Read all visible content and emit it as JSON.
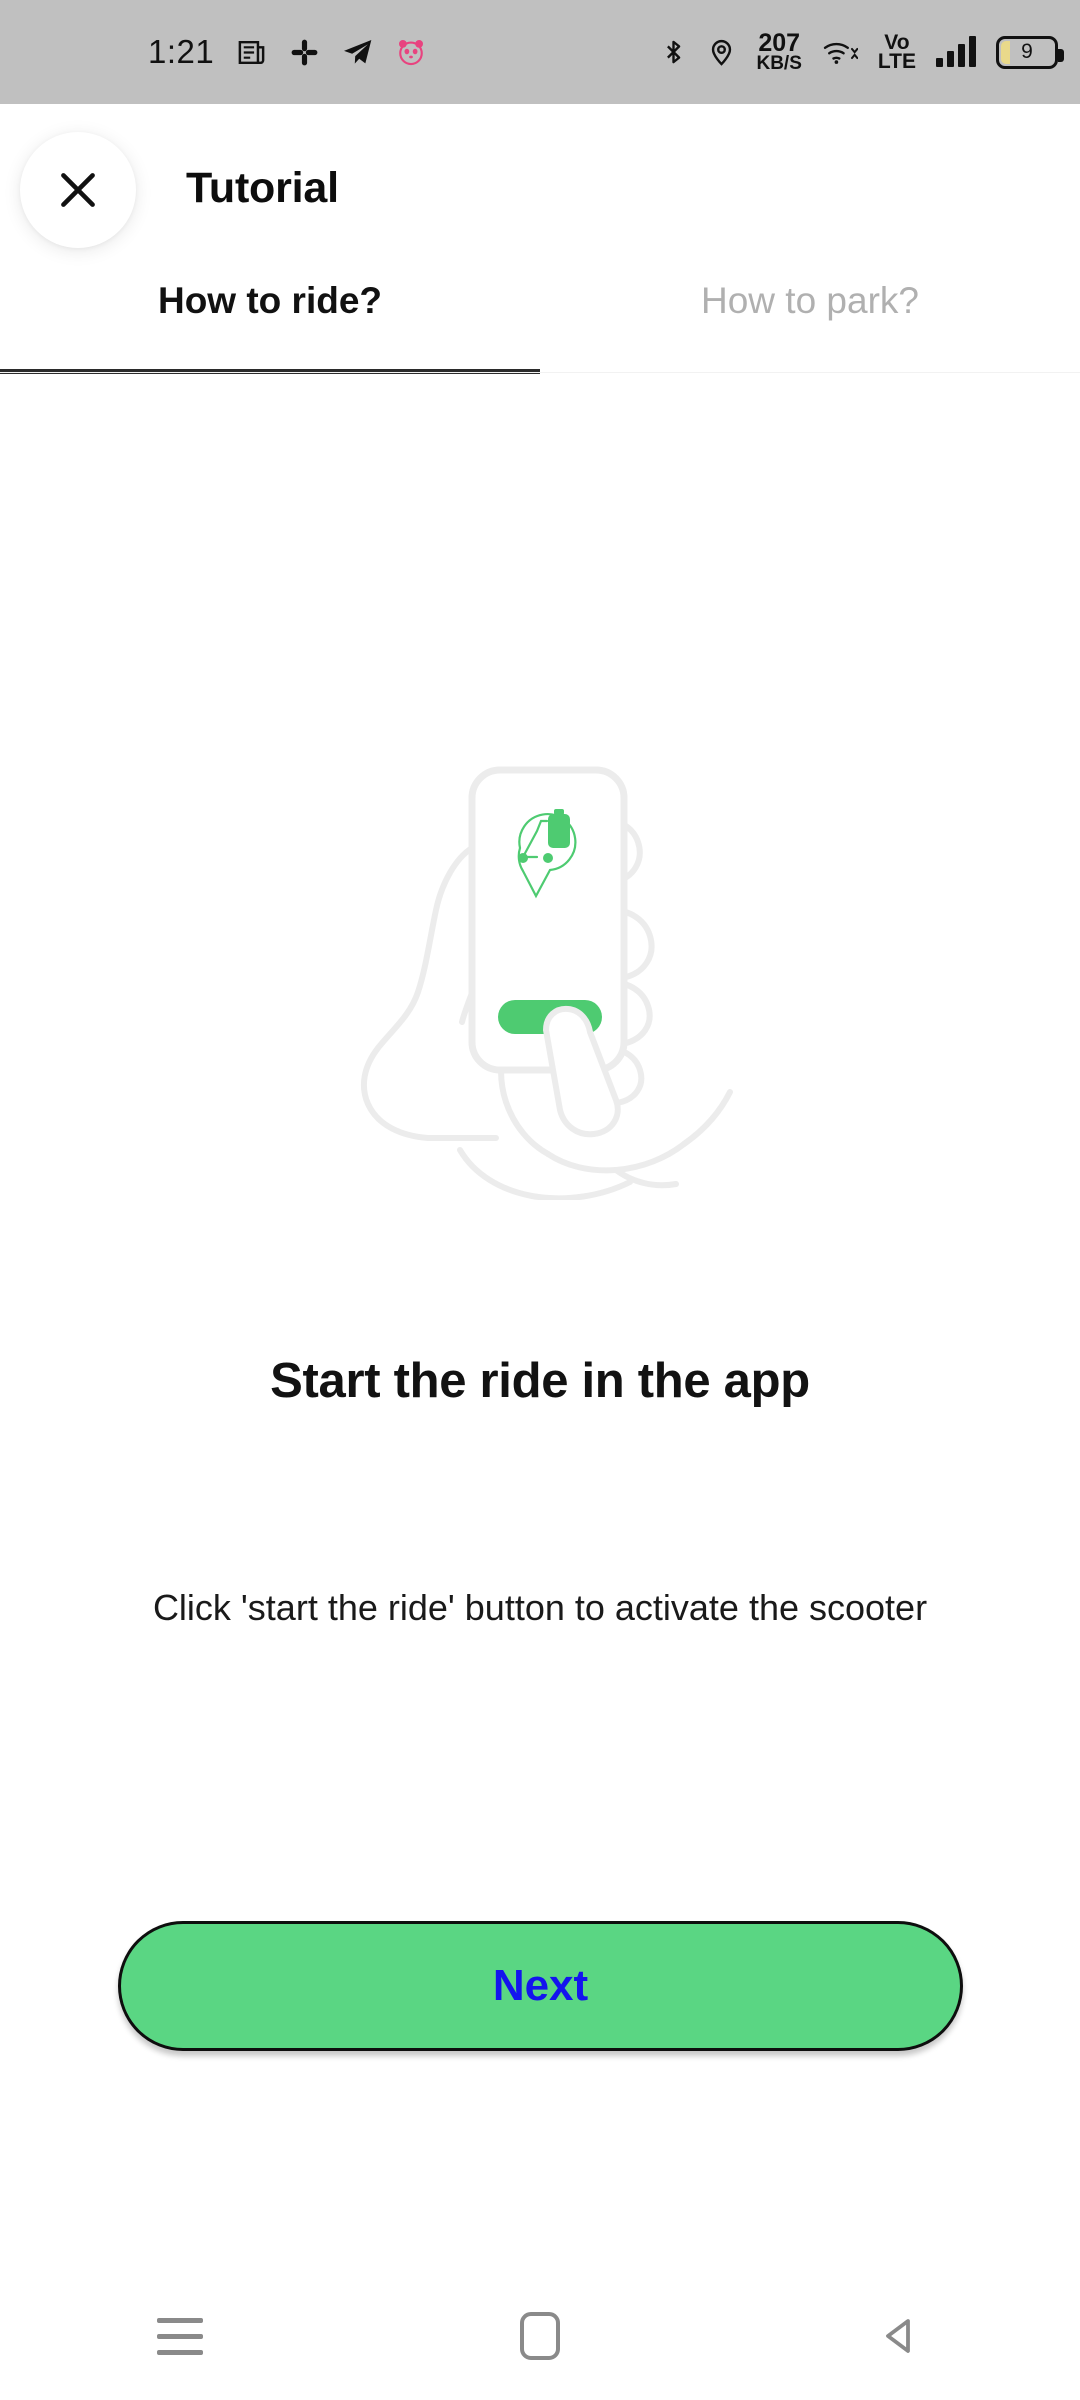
{
  "status_bar": {
    "time": "1:21",
    "notification_icons": [
      "news-feed-icon",
      "slack-icon",
      "telegram-icon",
      "panda-emoji-icon"
    ],
    "bluetooth_icon": "bluetooth-icon",
    "location_icon": "location-pin-icon",
    "network_speed_value": "207",
    "network_speed_unit": "KB/S",
    "wifi_icon": "wifi-icon",
    "volte_line1": "Vo",
    "volte_line2": "LTE",
    "signal_icon": "cellular-signal-icon",
    "battery_level": "9"
  },
  "header": {
    "close_label": "close-icon",
    "title": "Tutorial"
  },
  "tabs": [
    {
      "label": "How to ride?",
      "active": true
    },
    {
      "label": "How to park?",
      "active": false
    }
  ],
  "illustration": {
    "name": "hand-holding-phone-pressing-button-illustration",
    "phone_logo": "scooter-location-pin-with-battery-icon",
    "in_app_button_color": "#4ecb71",
    "outline_color": "#ececec",
    "accent_color": "#4ecb71"
  },
  "content": {
    "heading": "Start the ride in the app",
    "body": "Click 'start the ride' button to activate the scooter"
  },
  "primary_button": {
    "label": "Next",
    "background": "#5ad683",
    "text_color": "#1414ee",
    "border_color": "#0e0e0e"
  },
  "nav_bar": {
    "recents_label": "recents-icon",
    "home_label": "home-icon",
    "back_label": "back-icon"
  }
}
